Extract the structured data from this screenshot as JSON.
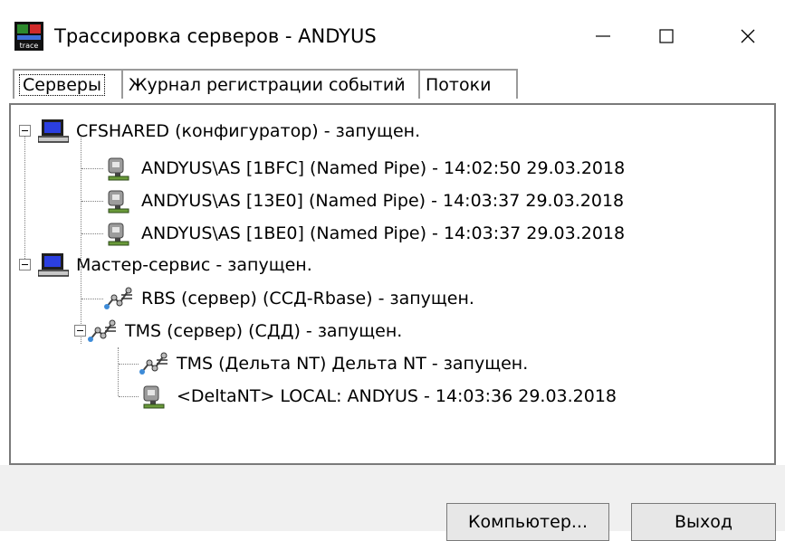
{
  "window": {
    "title": "Трассировка серверов - ANDYUS",
    "icon_label": "trace",
    "controls": [
      "minimize-icon",
      "maximize-icon",
      "close-icon"
    ]
  },
  "tabs": [
    {
      "label": "Серверы",
      "active": true
    },
    {
      "label": "Журнал регистрации событий",
      "active": false
    },
    {
      "label": "Потоки",
      "active": false
    }
  ],
  "tree": [
    {
      "icon": "computer-icon",
      "text": "CFSHARED (конфигуратор)  - запущен.",
      "level": 0,
      "expanded": true
    },
    {
      "icon": "user-session-icon",
      "text": "ANDYUS\\AS [1BFC] (Named Pipe)   - 14:02:50  29.03.2018",
      "level": 1
    },
    {
      "icon": "user-session-icon",
      "text": "ANDYUS\\AS [13E0] (Named Pipe)   - 14:03:37  29.03.2018",
      "level": 1
    },
    {
      "icon": "user-session-icon",
      "text": "ANDYUS\\AS [1BE0] (Named Pipe)   - 14:03:37  29.03.2018",
      "level": 1
    },
    {
      "icon": "computer-icon",
      "text": "Мастер-сервис   - запущен.",
      "level": 0,
      "expanded": true
    },
    {
      "icon": "network-service-icon",
      "text": "RBS (сервер) (ССД-Rbase)  - запущен.",
      "level": 1
    },
    {
      "icon": "network-service-icon",
      "text": "TMS (сервер) (СДД)  - запущен.",
      "level": 1,
      "expanded": true
    },
    {
      "icon": "network-service-icon",
      "text": "TMS (Дельта NT) Дельта NT  - запущен.",
      "level": 2
    },
    {
      "icon": "user-session-icon",
      "text": "<DeltaNT> LOCAL: ANDYUS - 14:03:36  29.03.2018",
      "level": 2
    }
  ],
  "buttons": {
    "computer": "Компьютер...",
    "exit": "Выход"
  }
}
